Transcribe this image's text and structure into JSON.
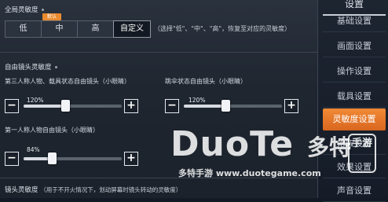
{
  "sidebar": {
    "header": "设置",
    "items": [
      {
        "label": "基础设置"
      },
      {
        "label": "画面设置"
      },
      {
        "label": "操作设置"
      },
      {
        "label": "载具设置"
      },
      {
        "label": "灵敏度设置"
      },
      {
        "label": "拾取设置"
      },
      {
        "label": "效果设置"
      },
      {
        "label": "声音设置"
      }
    ],
    "active_index": 4
  },
  "global": {
    "title": "全局灵敏度",
    "options": [
      "低",
      "中",
      "高",
      "自定义"
    ],
    "selected": "自定义",
    "badge": "默认",
    "hint": "（选择\"低\"、\"中\"、\"高\"，恢复至对应的灵敏度）"
  },
  "free_camera": {
    "title": "自由镜头灵敏度",
    "sliders": [
      {
        "label": "第三人称人物、载具状态自由镜头（小眼睛）",
        "value_text": "120%",
        "level": 0.42
      },
      {
        "label": "跳伞状态自由镜头（小眼睛）",
        "value_text": "120%",
        "level": 0.42
      },
      {
        "label": "第一人称人物自由镜头（小眼睛）",
        "value_text": "84%",
        "level": 0.29
      }
    ]
  },
  "camera": {
    "title": "镜头灵敏度",
    "hint": "（用于不开火情况下，划动屏幕时镜头转动的灵敏度）"
  },
  "watermark": {
    "logo": "DuoTe",
    "cn": "多特",
    "box": "手游",
    "url": "多特手游 www.duotegame.com"
  },
  "colors": {
    "accent": "#e8792a",
    "badge": "#e88a2f"
  }
}
